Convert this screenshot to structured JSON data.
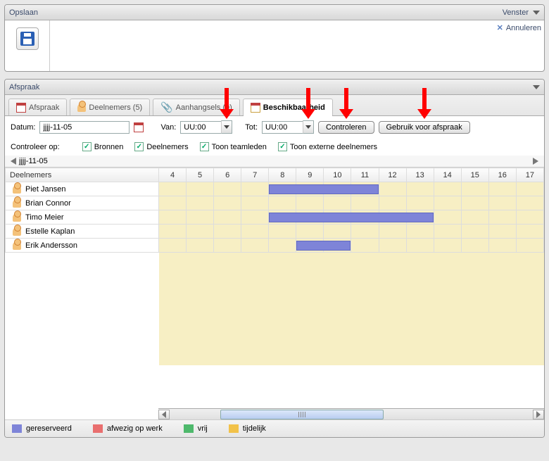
{
  "top_panel": {
    "save_label": "Opslaan",
    "window_label": "Venster",
    "cancel_label": "Annuleren"
  },
  "appointment_panel": {
    "title": "Afspraak",
    "tabs": {
      "appointment": "Afspraak",
      "participants": "Deelnemers (5)",
      "attachments": "Aanhangsels (0)",
      "availability": "Beschikbaarheid"
    },
    "form": {
      "date_label": "Datum:",
      "date_value": "jjjj-11-05",
      "from_label": "Van:",
      "from_value": "UU:00",
      "to_label": "Tot:",
      "to_value": "UU:00",
      "check_button": "Controleren",
      "use_button": "Gebruik voor afspraak"
    },
    "checkrow": {
      "label": "Controleer op:",
      "resources": "Bronnen",
      "participants": "Deelnemers",
      "teammembers": "Toon teamleden",
      "external": "Toon externe deelnemers"
    },
    "nav_date": "jjjj-11-05",
    "grid": {
      "col_header": "Deelnemers",
      "hours": [
        "4",
        "5",
        "6",
        "7",
        "8",
        "9",
        "10",
        "11",
        "12",
        "13",
        "14",
        "15",
        "16",
        "17"
      ],
      "rows": [
        {
          "name": "Piet Jansen",
          "busy": [
            8,
            12
          ]
        },
        {
          "name": "Brian Connor",
          "busy": null
        },
        {
          "name": "Timo Meier",
          "busy": [
            8,
            14
          ]
        },
        {
          "name": "Estelle Kaplan",
          "busy": null
        },
        {
          "name": "Erik Andersson",
          "busy": [
            9,
            11
          ]
        }
      ]
    },
    "legend": {
      "reserved": "gereserveerd",
      "away": "afwezig op werk",
      "free": "vrij",
      "temporary": "tijdelijk"
    },
    "colors": {
      "reserved": "#7e84d8",
      "away": "#e96f6f",
      "free": "#4eb96c",
      "temporary": "#f2c24a"
    }
  }
}
